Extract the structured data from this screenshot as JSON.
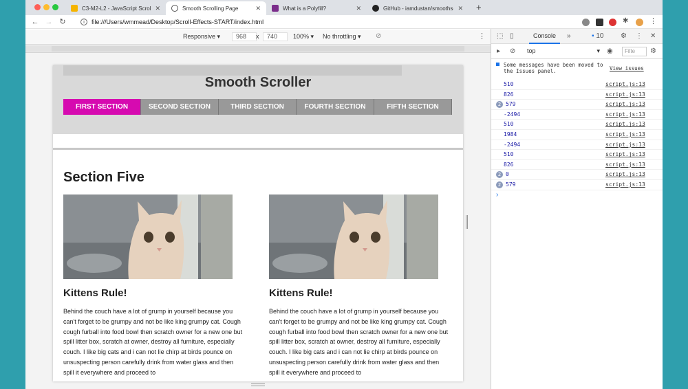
{
  "browser": {
    "tabs": [
      {
        "title": "C3-M2-L2 - JavaScript Scroll",
        "fav_color": "#f5b400",
        "fav_glyph": ""
      },
      {
        "title": "Smooth Scrolling Page",
        "fav_color": "#ffffff",
        "fav_glyph": "◉"
      },
      {
        "title": "What is a Polyfill?",
        "fav_color": "#7b2d8b",
        "fav_glyph": ""
      },
      {
        "title": "GitHub - iamdustan/smoothsc",
        "fav_color": "#ffffff",
        "fav_glyph": "●"
      }
    ],
    "url": "file:///Users/wmmead/Desktop/Scroll-Effects-START/index.html"
  },
  "device_toolbar": {
    "mode": "Responsive",
    "width": "968",
    "times": "x",
    "height": "740",
    "zoom": "100%",
    "throttling": "No throttling"
  },
  "page": {
    "title": "Smooth Scroller",
    "nav": [
      "FIRST SECTION",
      "SECOND SECTION",
      "THIRD SECTION",
      "FOURTH SECTION",
      "FIFTH SECTION"
    ],
    "section_heading": "Section Five",
    "cards": [
      {
        "title": "Kittens Rule!",
        "text": "Behind the couch have a lot of grump in yourself because you can't forget to be grumpy and not be like king grumpy cat. Cough cough furball into food bowl then scratch owner for a new one but spill litter box, scratch at owner, destroy all furniture, especially couch. I like big cats and i can not lie chirp at birds pounce on unsuspecting person carefully drink from water glass and then spill it everywhere and proceed to"
      },
      {
        "title": "Kittens Rule!",
        "text": "Behind the couch have a lot of grump in yourself because you can't forget to be grumpy and not be like king grumpy cat. Cough cough furball into food bowl then scratch owner for a new one but spill litter box, scratch at owner, destroy all furniture, especially couch. I like big cats and i can not lie chirp at birds pounce on unsuspecting person carefully drink from water glass and then spill it everywhere and proceed to"
      }
    ]
  },
  "devtools": {
    "tab": "Console",
    "issues_count": "10",
    "context": "top",
    "filter_placeholder": "Filte",
    "issues_message": "Some messages have been moved to the Issues panel.",
    "issues_link": "View issues",
    "logs": [
      {
        "count": "",
        "value": "510",
        "src": "script.js:13"
      },
      {
        "count": "",
        "value": "826",
        "src": "script.js:13"
      },
      {
        "count": "2",
        "value": "579",
        "src": "script.js:13"
      },
      {
        "count": "",
        "value": "-2494",
        "src": "script.js:13"
      },
      {
        "count": "",
        "value": "510",
        "src": "script.js:13"
      },
      {
        "count": "",
        "value": "1984",
        "src": "script.js:13"
      },
      {
        "count": "",
        "value": "-2494",
        "src": "script.js:13"
      },
      {
        "count": "",
        "value": "510",
        "src": "script.js:13"
      },
      {
        "count": "",
        "value": "826",
        "src": "script.js:13"
      },
      {
        "count": "2",
        "value": "0",
        "src": "script.js:13"
      },
      {
        "count": "2",
        "value": "579",
        "src": "script.js:13"
      }
    ]
  }
}
